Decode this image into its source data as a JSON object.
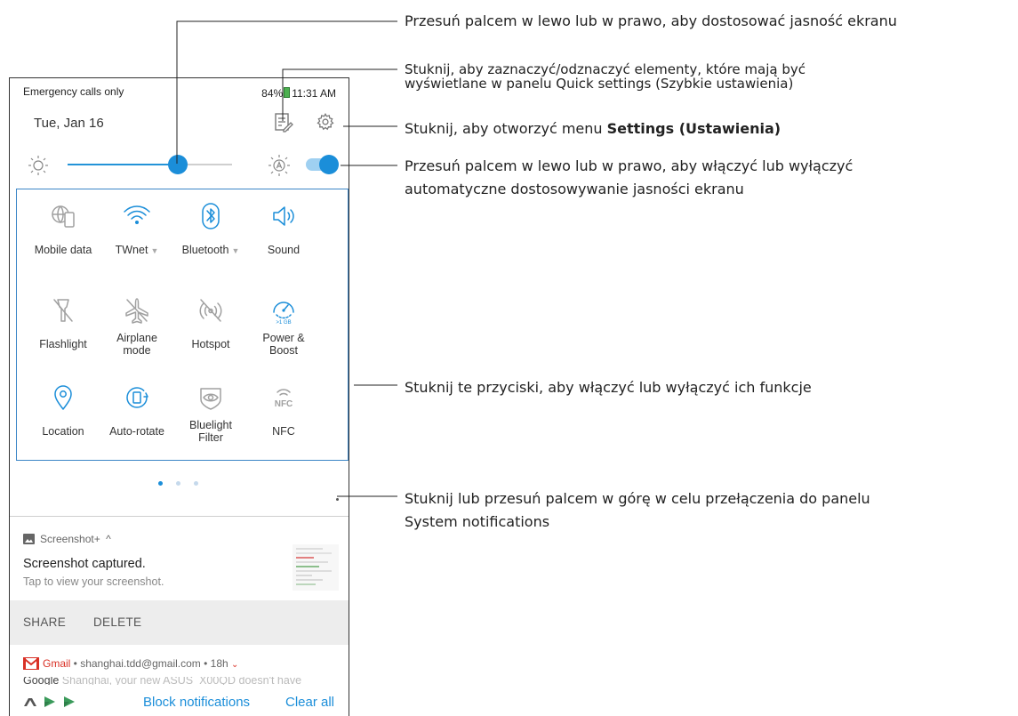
{
  "status_bar": {
    "left_text": "Emergency calls only",
    "battery": "84%",
    "time": "11:31 AM"
  },
  "header": {
    "date": "Tue, Jan 16"
  },
  "brightness": {
    "level": 0.67,
    "auto_enabled": true
  },
  "tiles": [
    {
      "label": "Mobile data",
      "icon": "globe-phone-icon",
      "active": false,
      "caret": false
    },
    {
      "label": "TWnet",
      "icon": "wifi-icon",
      "active": true,
      "caret": true
    },
    {
      "label": "Bluetooth",
      "icon": "bluetooth-icon",
      "active": true,
      "caret": true
    },
    {
      "label": "Sound",
      "icon": "speaker-icon",
      "active": true,
      "caret": false
    },
    {
      "label": "Flashlight",
      "icon": "flashlight-off-icon",
      "active": false,
      "caret": false
    },
    {
      "label": "Airplane\nmode",
      "icon": "airplane-off-icon",
      "active": false,
      "caret": false
    },
    {
      "label": "Hotspot",
      "icon": "hotspot-off-icon",
      "active": false,
      "caret": false
    },
    {
      "label": "Power &\nBoost",
      "icon": "gauge-icon",
      "active": true,
      "caret": false,
      "badge": ">1 GB"
    },
    {
      "label": "Location",
      "icon": "location-pin-icon",
      "active": true,
      "caret": false
    },
    {
      "label": "Auto-rotate",
      "icon": "auto-rotate-icon",
      "active": true,
      "caret": false
    },
    {
      "label": "Bluelight\nFilter",
      "icon": "eye-filter-icon",
      "active": false,
      "caret": false
    },
    {
      "label": "NFC",
      "icon": "nfc-icon",
      "active": false,
      "caret": false
    }
  ],
  "pager": {
    "pages": 3,
    "current": 1
  },
  "notification": {
    "app": "Screenshot+",
    "chevron": "^",
    "title": "Screenshot captured.",
    "subtitle": "Tap to view your screenshot.",
    "actions": [
      "SHARE",
      "DELETE"
    ]
  },
  "gmail": {
    "app": "Gmail",
    "meta": " • shanghai.tdd@gmail.com • 18h",
    "chevron": "⌄",
    "preview_sender": "Google",
    "preview_text": "Shanghai, your new ASUS_X00QD doesn't have"
  },
  "footer": {
    "block": "Block notifications",
    "clear": "Clear all"
  },
  "callouts": {
    "c1": "Przesuń palcem w lewo lub w prawo, aby dostosować jasność ekranu",
    "c2_line1": "Stuknij, aby zaznaczyć/odznaczyć elementy, które mają być",
    "c2_line2": "wyświetlane w panelu Quick settings (Szybkie ustawienia)",
    "c3_prefix": "Stuknij, aby otworzyć menu ",
    "c3_bold": "Settings (Ustawienia)",
    "c4_line1": "Przesuń palcem w lewo lub w prawo, aby włączyć lub wyłączyć",
    "c4_line2": "automatyczne dostosowywanie jasności ekranu",
    "c5": "Stuknij te przyciski, aby włączyć lub wyłączyć ich funkcje",
    "c6_line1": "Stuknij lub przesuń palcem w górę w celu przełączenia do panelu",
    "c6_line2": "System notifications"
  },
  "colors": {
    "accent": "#1b8ed9",
    "inactive": "#a0a0a0",
    "gmail": "#d93025"
  }
}
